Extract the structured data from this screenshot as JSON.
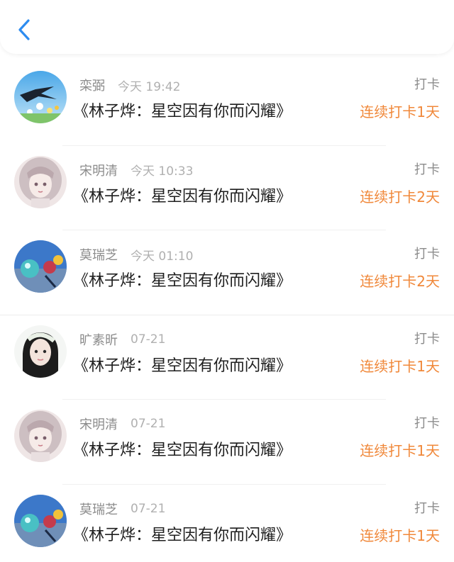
{
  "header": {
    "back_icon": "chevron-left-icon",
    "accent_color": "#2d8cf0"
  },
  "records": [
    {
      "name": "栾弼",
      "time": "今天 19:42",
      "action": "打卡",
      "book": "《林子烨：星空因有你而闪耀》",
      "streak": "连续打卡1天",
      "avatar": "swallow-bird-avatar"
    },
    {
      "name": "宋明清",
      "time": "今天 10:33",
      "action": "打卡",
      "book": "《林子烨：星空因有你而闪耀》",
      "streak": "连续打卡2天",
      "avatar": "anime-girl-avatar"
    },
    {
      "name": "莫瑞芝",
      "time": "今天 01:10",
      "action": "打卡",
      "book": "《林子烨：星空因有你而闪耀》",
      "streak": "连续打卡2天",
      "avatar": "glass-marble-avatar"
    },
    {
      "name": "旷素昕",
      "time": "07-21",
      "action": "打卡",
      "book": "《林子烨：星空因有你而闪耀》",
      "streak": "连续打卡1天",
      "avatar": "girl-photo-avatar"
    },
    {
      "name": "宋明清",
      "time": "07-21",
      "action": "打卡",
      "book": "《林子烨：星空因有你而闪耀》",
      "streak": "连续打卡1天",
      "avatar": "anime-girl-avatar"
    },
    {
      "name": "莫瑞芝",
      "time": "07-21",
      "action": "打卡",
      "book": "《林子烨：星空因有你而闪耀》",
      "streak": "连续打卡1天",
      "avatar": "glass-marble-avatar"
    }
  ],
  "colors": {
    "streak": "#f0883a",
    "name": "#8c8c8c",
    "time": "#b0b0b0",
    "title": "#1e1e1e"
  }
}
